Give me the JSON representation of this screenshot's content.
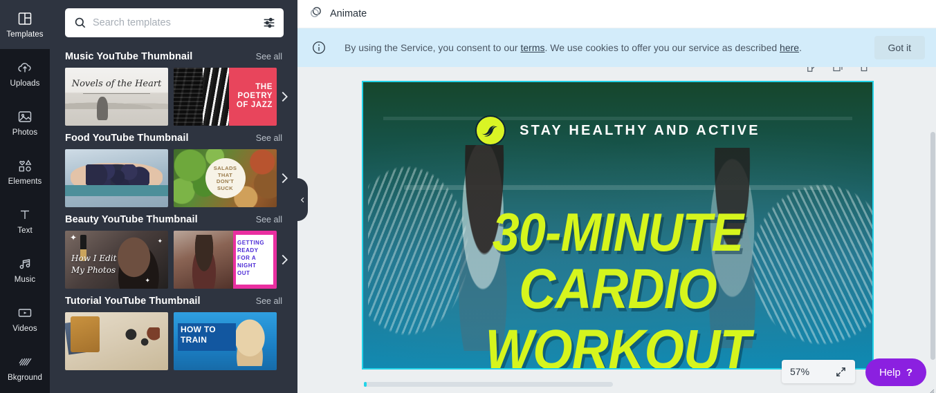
{
  "rail": {
    "items": [
      {
        "label": "Templates",
        "icon": "templates-icon",
        "active": true
      },
      {
        "label": "Uploads",
        "icon": "upload-cloud-icon",
        "active": false
      },
      {
        "label": "Photos",
        "icon": "photo-icon",
        "active": false
      },
      {
        "label": "Elements",
        "icon": "shapes-icon",
        "active": false
      },
      {
        "label": "Text",
        "icon": "text-icon",
        "active": false
      },
      {
        "label": "Music",
        "icon": "music-note-icon",
        "active": false
      },
      {
        "label": "Videos",
        "icon": "video-icon",
        "active": false
      },
      {
        "label": "Bkground",
        "icon": "background-hatch-icon",
        "active": false
      }
    ]
  },
  "search": {
    "placeholder": "Search templates",
    "value": "",
    "icon": "search-icon",
    "filter_icon": "filter-sliders-icon"
  },
  "panel": {
    "see_all_label": "See all",
    "sections": [
      {
        "title": "Music YouTube Thumbnail",
        "cards": [
          {
            "name": "novels-of-the-heart-thumbnail",
            "text": "Novels of the Heart"
          },
          {
            "name": "poetry-of-jazz-thumbnail",
            "text": "THE POETRY OF JAZZ"
          }
        ]
      },
      {
        "title": "Food YouTube Thumbnail",
        "cards": [
          {
            "name": "blueberries-thumbnail",
            "text": ""
          },
          {
            "name": "salads-that-dont-suck-thumbnail",
            "text": "SALADS THAT DON'T SUCK"
          }
        ]
      },
      {
        "title": "Beauty YouTube Thumbnail",
        "cards": [
          {
            "name": "how-i-edit-my-photos-thumbnail",
            "text": "How I Edit My Photos"
          },
          {
            "name": "getting-ready-night-out-thumbnail",
            "text": "GETTING READY FOR A NIGHT OUT"
          }
        ]
      },
      {
        "title": "Tutorial YouTube Thumbnail",
        "cards": [
          {
            "name": "desk-flatlay-thumbnail",
            "text": ""
          },
          {
            "name": "how-to-train-thumbnail",
            "text": "HOW TO TRAIN"
          }
        ]
      }
    ]
  },
  "topbar": {
    "animate_label": "Animate",
    "animate_icon": "animate-circles-icon"
  },
  "cookie_banner": {
    "info_icon": "info-circle-icon",
    "text_before_terms": "By using the Service, you consent to our ",
    "terms_link": "terms",
    "text_middle": ". We use cookies to offer you our service as described ",
    "here_link": "here",
    "text_end": ".",
    "button_label": "Got it",
    "background": "#d3ecfa"
  },
  "canvas": {
    "page_tools": [
      "edit-page-icon",
      "duplicate-page-icon",
      "delete-page-icon"
    ],
    "design": {
      "tagline": "STAY HEALTHY AND ACTIVE",
      "headline_line1": "30-MINUTE",
      "headline_line2": "CARDIO WORKOUT",
      "logo_icon": "wave-logo-icon",
      "accent_color": "#d6f51d",
      "logo_background": "#d9f425",
      "overlay_top_color": "#164a2d",
      "overlay_bottom_color": "#0e90ba"
    },
    "selection_color": "#23d3e8"
  },
  "bottom": {
    "zoom_value": "57%",
    "expand_icon": "expand-arrows-icon",
    "help_label": "Help",
    "help_question_mark": "?",
    "help_color": "#8b20e0"
  }
}
